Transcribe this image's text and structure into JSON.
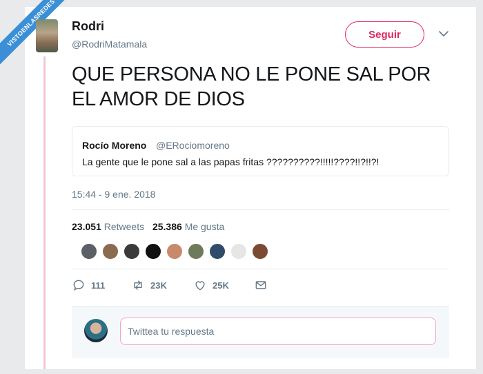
{
  "watermark": {
    "text": "VISTOENLASREDES"
  },
  "header": {
    "name": "Rodri",
    "handle": "@RodriMatamala",
    "follow_label": "Seguir"
  },
  "tweet": {
    "text": "QUE PERSONA NO LE PONE SAL POR EL AMOR DE DIOS",
    "timestamp": "15:44 - 9 ene. 2018"
  },
  "quote": {
    "name": "Rocío Moreno",
    "handle": "@ERociomoreno",
    "text": "La gente que le pone sal a las papas fritas ??????????!!!!!????!!?!!?!"
  },
  "stats": {
    "retweets_count": "23.051",
    "retweets_label": "Retweets",
    "likes_count": "25.386",
    "likes_label": "Me gusta"
  },
  "likers": [
    {
      "color": "#5b5f66"
    },
    {
      "color": "#8a6b4f"
    },
    {
      "color": "#3a3a3a"
    },
    {
      "color": "#111111"
    },
    {
      "color": "#c98a6b"
    },
    {
      "color": "#6f7a5a"
    },
    {
      "color": "#2f4c6a"
    },
    {
      "color": "#e6e6e6"
    },
    {
      "color": "#7b4a32"
    }
  ],
  "actions": {
    "reply_count": "111",
    "retweet_count": "23K",
    "like_count": "25K"
  },
  "reply": {
    "placeholder": "Twittea tu respuesta"
  },
  "colors": {
    "accent": "#e0245e",
    "secondary_text": "#657786",
    "watermark": "#3b8fd6"
  }
}
